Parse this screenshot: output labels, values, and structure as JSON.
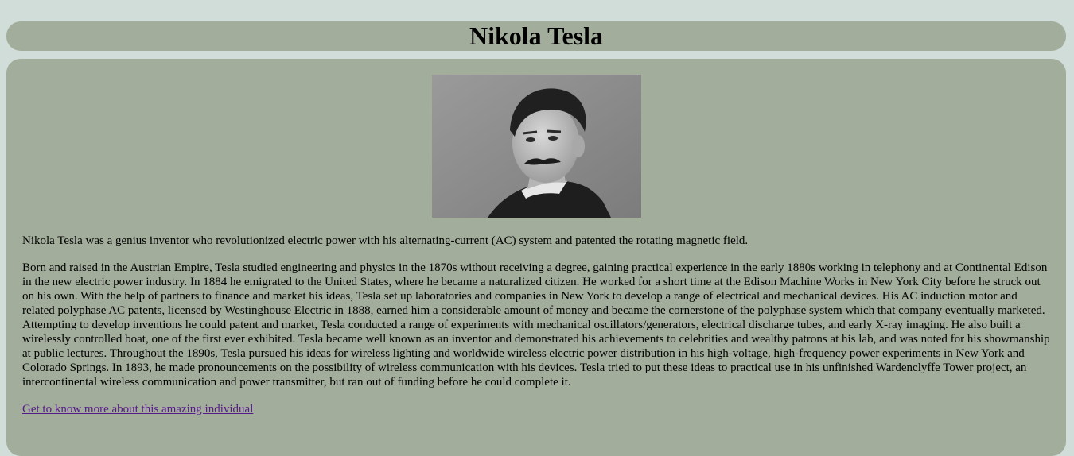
{
  "header": {
    "title": "Nikola Tesla"
  },
  "main": {
    "portrait": {
      "icon": "portrait-photo"
    },
    "intro": "Nikola Tesla was a genius inventor who revolutionized electric power with his alternating-current (AC) system and patented the rotating magnetic field.",
    "bio": "Born and raised in the Austrian Empire, Tesla studied engineering and physics in the 1870s without receiving a degree, gaining practical experience in the early 1880s working in telephony and at Continental Edison in the new electric power industry. In 1884 he emigrated to the United States, where he became a naturalized citizen. He worked for a short time at the Edison Machine Works in New York City before he struck out on his own. With the help of partners to finance and market his ideas, Tesla set up laboratories and companies in New York to develop a range of electrical and mechanical devices. His AC induction motor and related polyphase AC patents, licensed by Westinghouse Electric in 1888, earned him a considerable amount of money and became the cornerstone of the polyphase system which that company eventually marketed. Attempting to develop inventions he could patent and market, Tesla conducted a range of experiments with mechanical oscillators/generators, electrical discharge tubes, and early X-ray imaging. He also built a wirelessly controlled boat, one of the first ever exhibited. Tesla became well known as an inventor and demonstrated his achievements to celebrities and wealthy patrons at his lab, and was noted for his showmanship at public lectures. Throughout the 1890s, Tesla pursued his ideas for wireless lighting and worldwide wireless electric power distribution in his high-voltage, high-frequency power experiments in New York and Colorado Springs. In 1893, he made pronouncements on the possibility of wireless communication with his devices. Tesla tried to put these ideas to practical use in his unfinished Wardenclyffe Tower project, an intercontinental wireless communication and power transmitter, but ran out of funding before he could complete it.",
    "link_label": "Get to know more about this amazing individual"
  },
  "colors": {
    "page_background": "#d0ddd8",
    "panel_background": "#a3ad9c",
    "link": "#551a8b"
  }
}
